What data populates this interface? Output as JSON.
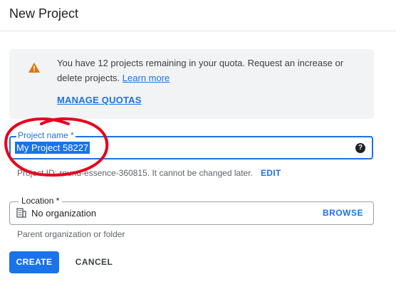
{
  "dialog": {
    "title": "New Project"
  },
  "quota": {
    "message": "You have 12 projects remaining in your quota. Request an increase or delete projects.",
    "learn_more": "Learn more",
    "manage_quotas": "MANAGE QUOTAS",
    "icon": "warning-icon"
  },
  "project_name": {
    "label": "Project name *",
    "value": "My Project 58227",
    "help_icon": "help-icon"
  },
  "project_id": {
    "text": "Project ID: round-essence-360815. It cannot be changed later.",
    "edit_label": "EDIT"
  },
  "location": {
    "label": "Location *",
    "value": "No organization",
    "browse_label": "BROWSE",
    "helper": "Parent organization or folder",
    "icon": "building-icon"
  },
  "actions": {
    "create_label": "CREATE",
    "cancel_label": "CANCEL"
  },
  "colors": {
    "accent": "#1a73e8",
    "warning": "#e37400",
    "annotation": "#e5001b"
  }
}
